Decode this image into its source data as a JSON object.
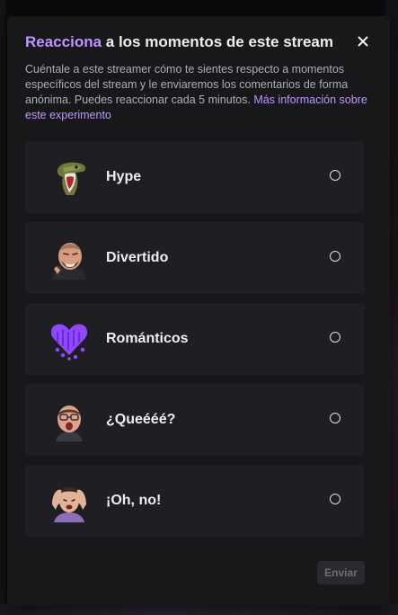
{
  "modal": {
    "title_accent": "Reacciona",
    "title_rest": " a los momentos de este stream",
    "description": "Cuéntale a este streamer cómo te sientes respecto a momentos específicos del stream y le enviaremos los comentarios de forma anónima. Puedes reaccionar cada 5 minutos. ",
    "more_info_link": "Más información sobre este experimento",
    "close_icon": "close-icon",
    "submit_label": "Enviar"
  },
  "options": [
    {
      "label": "Hype",
      "icon": "hype-emote-dinosaur",
      "selected": false
    },
    {
      "label": "Divertido",
      "icon": "funny-emote-laughing-man",
      "selected": false
    },
    {
      "label": "Románticos",
      "icon": "romantic-emote-purple-heart",
      "selected": false
    },
    {
      "label": "¿Queééé?",
      "icon": "surprised-emote-face",
      "selected": false
    },
    {
      "label": "¡Oh, no!",
      "icon": "oh-no-emote-head-in-hands",
      "selected": false
    }
  ],
  "colors": {
    "accent": "#bf94ff",
    "modal_bg": "#18181b",
    "card_bg": "#1f1f23",
    "text": "#efeff1",
    "muted_text": "#adadb8"
  }
}
